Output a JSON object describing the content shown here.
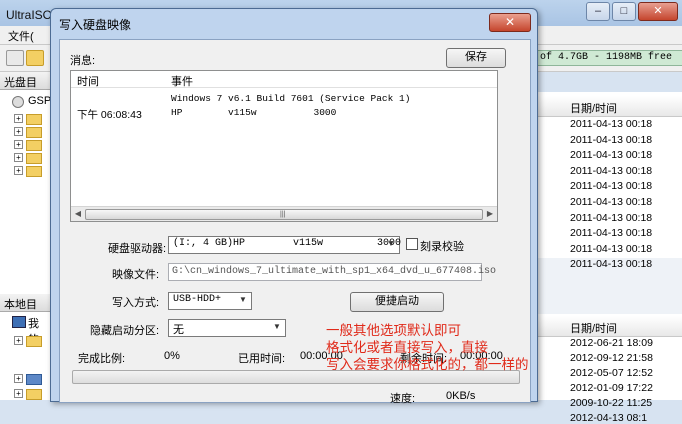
{
  "app": {
    "title": "UltraISO - 写入磁盘...",
    "menu": "文件(",
    "free_space": "of 4.7GB - 1198MB free",
    "left_panel_top": "光盘目",
    "left_panel_bottom": "本地目",
    "tree_root": "GSP",
    "tree_root2": "我的",
    "right_header": "日期/时间",
    "dates_top": [
      "2011-04-13 00:18",
      "2011-04-13 00:18",
      "2011-04-13 00:18",
      "2011-04-13 00:18",
      "2011-04-13 00:18",
      "2011-04-13 00:18",
      "2011-04-13 00:18",
      "2011-04-13 00:18",
      "2011-04-13 00:18",
      "2011-04-13 00:18"
    ],
    "dates_bottom": [
      "2012-06-21 18:09",
      "2012-09-12 21:58",
      "2012-05-07 12:52",
      "2012-01-09 17:22",
      "2009-10-22 11:25",
      "2012-04-13 08:1"
    ]
  },
  "dialog": {
    "title": "写入硬盘映像",
    "close_label": "✕",
    "message_label": "消息:",
    "save_label": "保存",
    "log_headers": [
      "时间",
      "事件"
    ],
    "log_rows": [
      {
        "time": "",
        "event": "Windows 7 v6.1 Build 7601 (Service Pack 1)"
      },
      {
        "time": "下午 06:08:43",
        "event": "HP        v115w          3000"
      }
    ],
    "drive_label": "硬盘驱动器:",
    "drive_value": "(I:, 4 GB)HP        v115w         3000",
    "verify_label": "刻录校验",
    "image_label": "映像文件:",
    "image_value": "G:\\cn_windows_7_ultimate_with_sp1_x64_dvd_u_677408.iso",
    "method_label": "写入方式:",
    "method_value": "USB-HDD+",
    "quick_boot_label": "便捷启动",
    "hidden_label": "隐藏启动分区:",
    "hidden_value": "无",
    "progress_label": "完成比例:",
    "progress_value": "0%",
    "elapsed_label": "已用时间:",
    "elapsed_value": "00:00:00",
    "remaining_label": "剩余时间:",
    "remaining_value": "00:00:00",
    "speed_label": "速度:",
    "speed_value": "0KB/s",
    "progress_fraction": 0
  },
  "annotation": {
    "line1": "一般其他选项默认即可",
    "line2": "格式化或者直接写入，直接",
    "line3": "写入会要求你格式化的，都一样的"
  }
}
